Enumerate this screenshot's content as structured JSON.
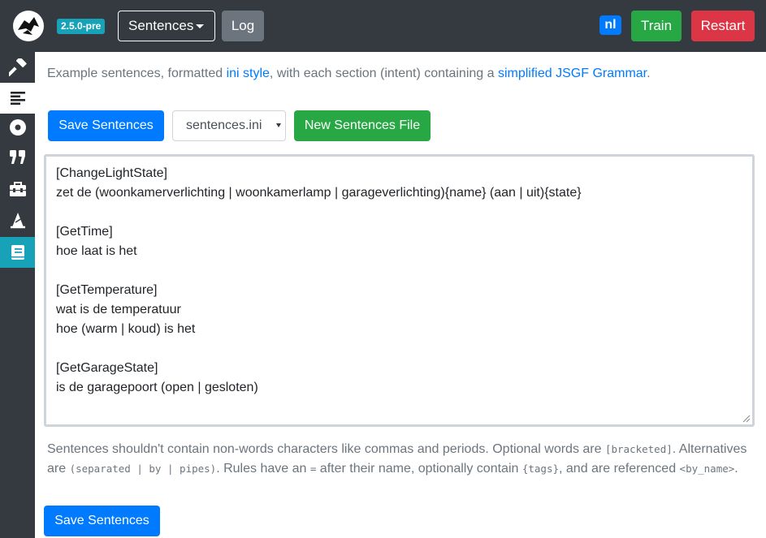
{
  "navbar": {
    "version": "2.5.0-pre",
    "page_dropdown": "Sentences",
    "log_button": "Log",
    "language_badge": "nl",
    "train_button": "Train",
    "restart_button": "Restart"
  },
  "sidebar": {
    "items": [
      {
        "icon": "hammer-icon",
        "active": false
      },
      {
        "icon": "sentences-icon",
        "active": true
      },
      {
        "icon": "record-icon",
        "active": false
      },
      {
        "icon": "quote-icon",
        "active": false
      },
      {
        "icon": "toolbox-icon",
        "active": false
      },
      {
        "icon": "wizard-icon",
        "active": false
      },
      {
        "icon": "book-icon",
        "active": false
      }
    ]
  },
  "intro": {
    "part1": "Example sentences, formatted ",
    "link1": "ini style",
    "part2": ", with each section (intent) containing a ",
    "link2": "simplified JSGF Grammar",
    "part3": "."
  },
  "toolbar": {
    "save_label": "Save Sentences",
    "file_selected": "sentences.ini",
    "new_file_label": "New Sentences File"
  },
  "editor": {
    "lines": [
      "[ChangeLightState]",
      "zet de (woonkamerverlichting | woonkamerlamp | garageverlichting){name} (aan | uit){state}",
      "",
      "[GetTime]",
      "hoe laat is het",
      "",
      "[GetTemperature]",
      "wat is de temperatuur",
      "hoe (warm | koud) is het",
      "",
      "[GetGarageState]",
      "is de garagepoort (open | gesloten)"
    ]
  },
  "help": {
    "t1": "Sentences shouldn't contain non-words characters like commas and periods. Optional words are ",
    "c1": "[bracketed]",
    "t2": ". Alternatives",
    "t3": "are ",
    "c2": "(separated | by | pipes)",
    "t4": ". Rules have an ",
    "c3": "=",
    "t5": " after their name, optionally contain ",
    "c4": "{tags}",
    "t6": ", and are referenced ",
    "c5": "<by_name>",
    "t7": "."
  },
  "footer": {
    "save_label": "Save Sentences"
  },
  "colors": {
    "navbar": "#343a40",
    "primary": "#007bff",
    "success": "#28a745",
    "danger": "#dc3545",
    "info": "#17a2b8",
    "secondary": "#6c757d"
  }
}
